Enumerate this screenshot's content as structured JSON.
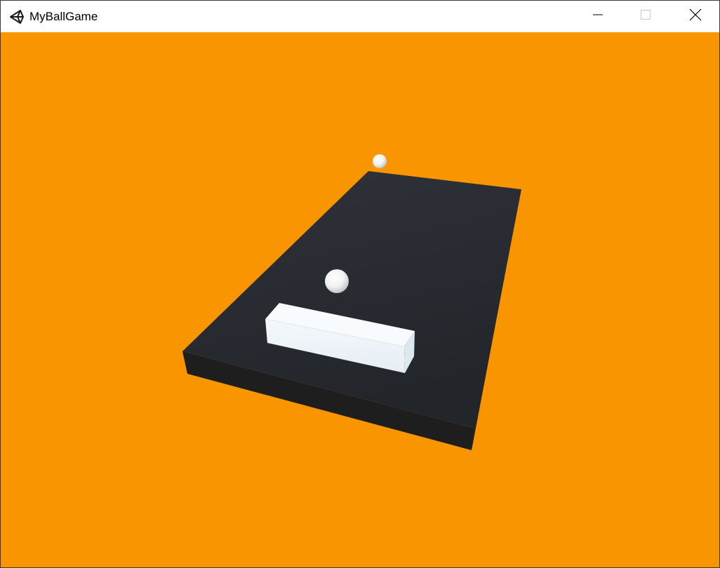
{
  "window": {
    "title": "MyBallGame",
    "app_icon": "unity-logo-icon",
    "controls": {
      "minimize_icon": "minimize-icon",
      "maximize_icon": "maximize-icon",
      "close_icon": "close-icon"
    }
  },
  "scene": {
    "background_color": "#f89500",
    "board_top_color": "#2b2e34",
    "board_side_color": "#1f1f1f",
    "block_color": "#eef4f8",
    "ball_color": "#ffffff",
    "objects": [
      "board",
      "block",
      "ball",
      "ball"
    ]
  }
}
